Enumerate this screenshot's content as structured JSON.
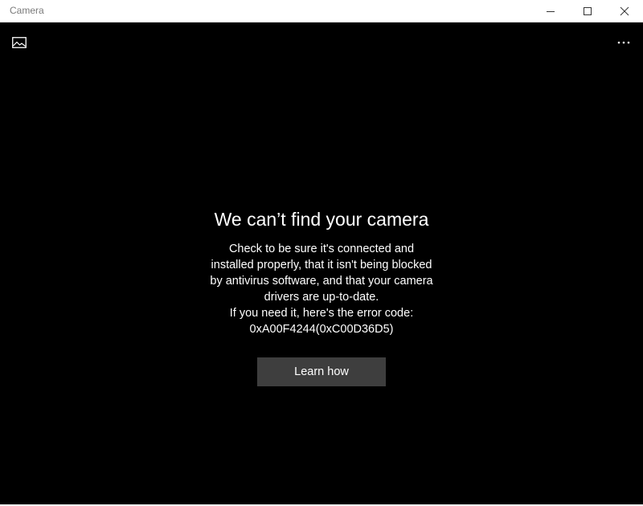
{
  "window": {
    "title": "Camera"
  },
  "toolbar": {
    "gallery_icon": "photo-gallery-icon",
    "more_icon": "more-options-icon"
  },
  "error": {
    "heading": "We can’t find your camera",
    "lines": [
      "Check to be sure it's connected and",
      "installed properly, that it isn't being blocked",
      "by antivirus software, and that your camera",
      "drivers are up-to-date.",
      "If you need it, here's the error code:",
      "0xA00F4244(0xC00D36D5)"
    ],
    "button_label": "Learn how"
  },
  "colors": {
    "background": "#000000",
    "titlebar": "#ffffff",
    "button": "#3e3e3e",
    "text": "#ffffff"
  }
}
